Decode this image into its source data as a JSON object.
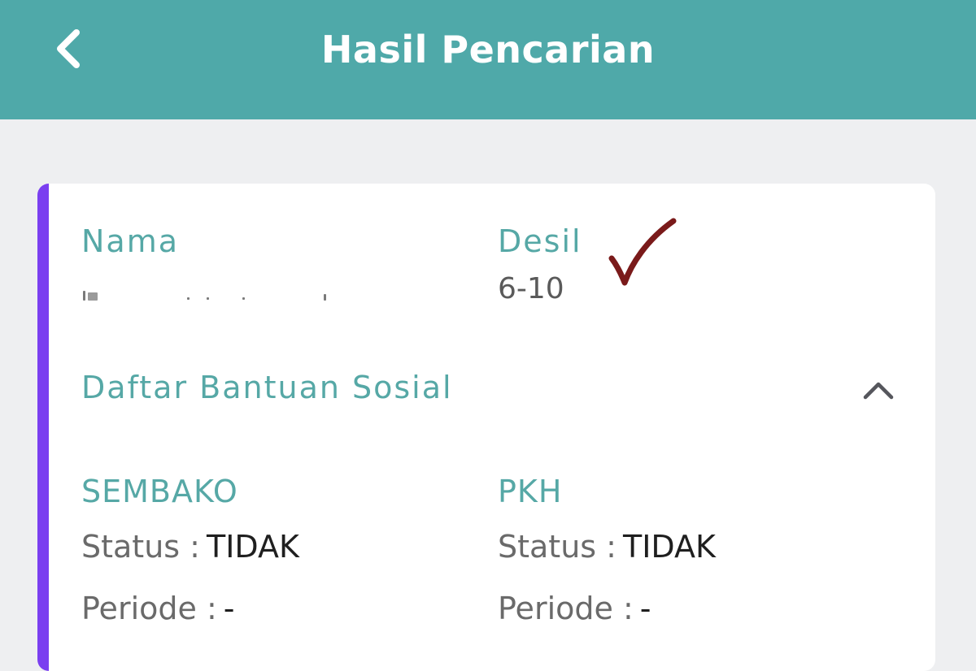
{
  "header": {
    "title": "Hasil Pencarian",
    "back_icon": "chevron-left-icon"
  },
  "card": {
    "accent_color": "#7a3ff0",
    "nama_label": "Nama",
    "desil_label": "Desil",
    "desil_value": "6-10",
    "section_title": "Daftar Bantuan Sosial",
    "collapse_icon": "chevron-up-icon",
    "programs": [
      {
        "name": "SEMBAKO",
        "status_label": "Status :",
        "status_value": "TIDAK",
        "periode_label": "Periode :",
        "periode_value": "-"
      },
      {
        "name": "PKH",
        "status_label": "Status :",
        "status_value": "TIDAK",
        "periode_label": "Periode :",
        "periode_value": "-"
      }
    ]
  },
  "colors": {
    "header_bg": "#4fa9a9",
    "teal_text": "#56a8a6",
    "checkmark": "#7a1a1a"
  }
}
